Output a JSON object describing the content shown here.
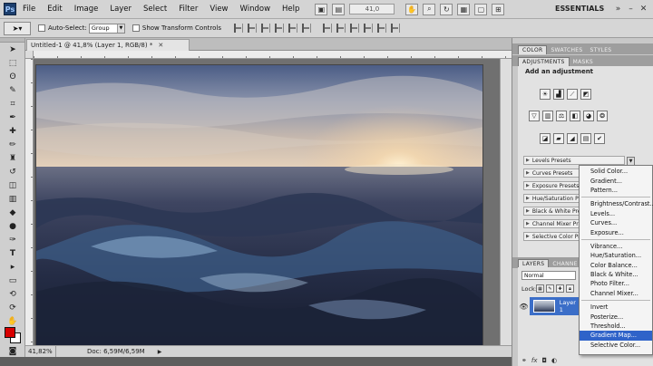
{
  "app": {
    "logo": "Ps",
    "menu": [
      "File",
      "Edit",
      "Image",
      "Layer",
      "Select",
      "Filter",
      "View",
      "Window",
      "Help"
    ],
    "zoom_field": "41,0",
    "workspace": "ESSENTIALS"
  },
  "options": {
    "auto_select_label": "Auto-Select:",
    "auto_select_value": "Group",
    "transform_label": "Show Transform Controls"
  },
  "document": {
    "tab_title": "Untitled-1 @ 41,8% (Layer 1, RGB/8) *",
    "status_zoom": "41,82%",
    "status_doc": "Doc: 6,59M/6,59M"
  },
  "panels": {
    "top_tabs": [
      "COLOR",
      "SWATCHES",
      "STYLES"
    ],
    "adj_tabs": [
      "ADJUSTMENTS",
      "MASKS"
    ],
    "adj_title": "Add an adjustment",
    "presets": [
      "Levels Presets",
      "Curves Presets",
      "Exposure Presets",
      "Hue/Saturation Pr",
      "Black & White Pre",
      "Channel Mixer Pr",
      "Selective Color Pr"
    ],
    "layer_tabs": [
      "LAYERS",
      "CHANNE"
    ],
    "blend_mode": "Normal",
    "lock_label": "Lock:",
    "layer_name": "Layer 1"
  },
  "context_menu": {
    "groups": [
      [
        "Solid Color...",
        "Gradient...",
        "Pattern..."
      ],
      [
        "Brightness/Contrast...",
        "Levels...",
        "Curves...",
        "Exposure..."
      ],
      [
        "Vibrance...",
        "Hue/Saturation...",
        "Color Balance...",
        "Black & White...",
        "Photo Filter...",
        "Channel Mixer..."
      ],
      [
        "Invert",
        "Posterize...",
        "Threshold...",
        "Gradient Map...",
        "Selective Color..."
      ]
    ],
    "selected": "Gradient Map..."
  },
  "colors": {
    "foreground": "#d80000",
    "background": "#ffffff",
    "selection": "#2f63c9"
  }
}
